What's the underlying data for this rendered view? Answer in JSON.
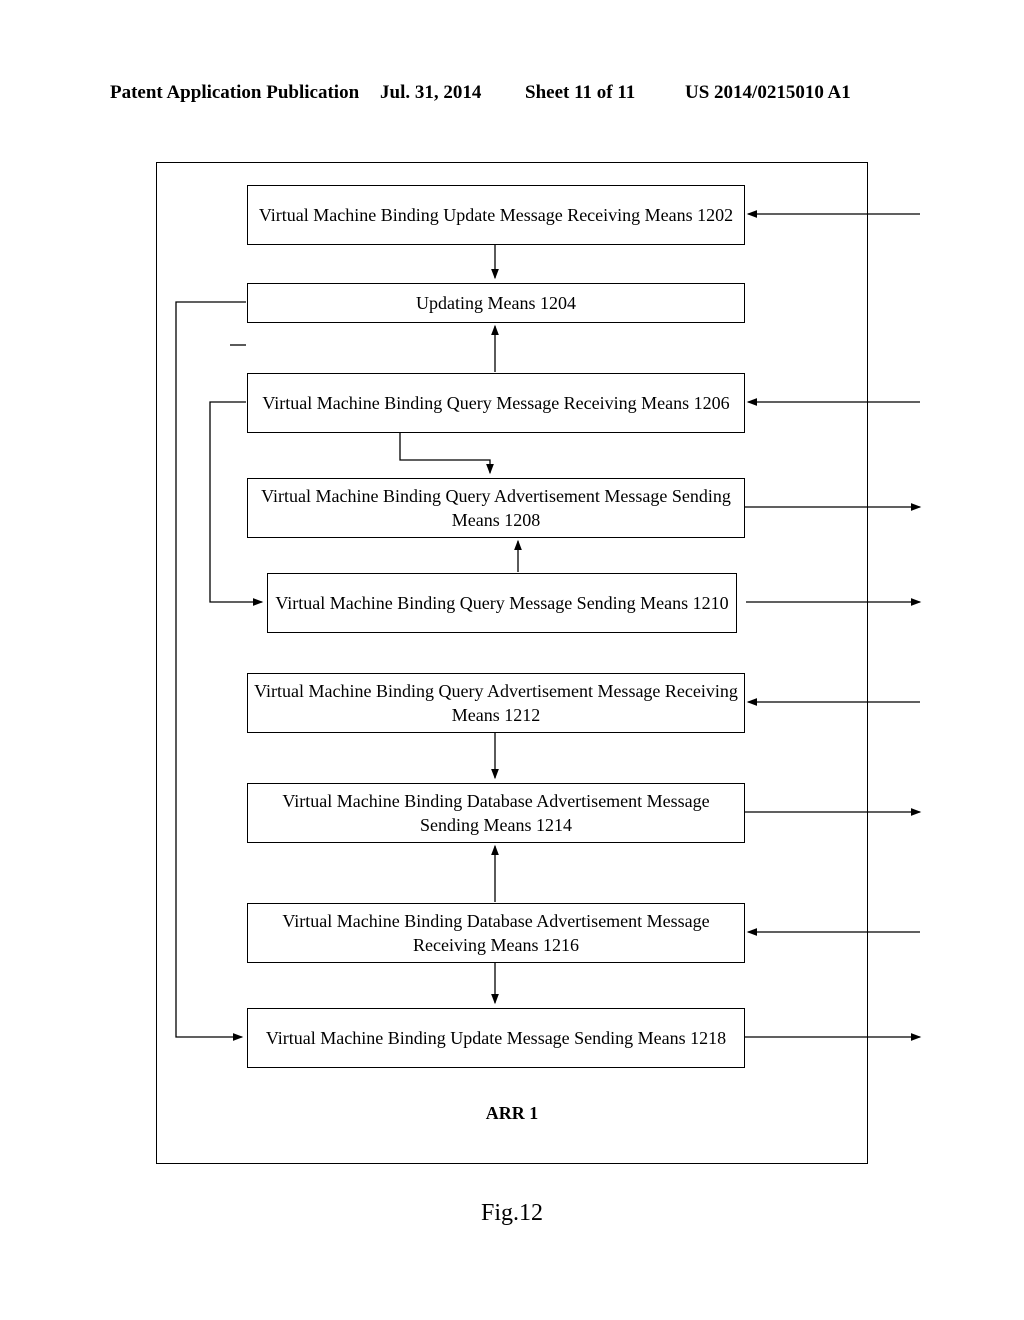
{
  "header": {
    "left": "Patent Application Publication",
    "date": "Jul. 31, 2014",
    "sheet": "Sheet 11 of 11",
    "pubno": "US 2014/0215010 A1"
  },
  "boxes": {
    "b1202": "Virtual Machine Binding Update Message Receiving Means 1202",
    "b1204": "Updating Means 1204",
    "b1206": "Virtual Machine Binding Query Message Receiving Means 1206",
    "b1208": "Virtual Machine Binding Query Advertisement Message Sending Means 1208",
    "b1210": "Virtual Machine Binding Query Message Sending Means 1210",
    "b1212": "Virtual Machine Binding Query Advertisement Message Receiving Means 1212",
    "b1214": "Virtual Machine Binding Database Advertisement Message Sending Means 1214",
    "b1216": "Virtual Machine Binding Database Advertisement Message Receiving Means 1216",
    "b1218": "Virtual Machine Binding Update Message Sending Means 1218"
  },
  "labels": {
    "arr": "ARR 1",
    "fig": "Fig.12"
  }
}
